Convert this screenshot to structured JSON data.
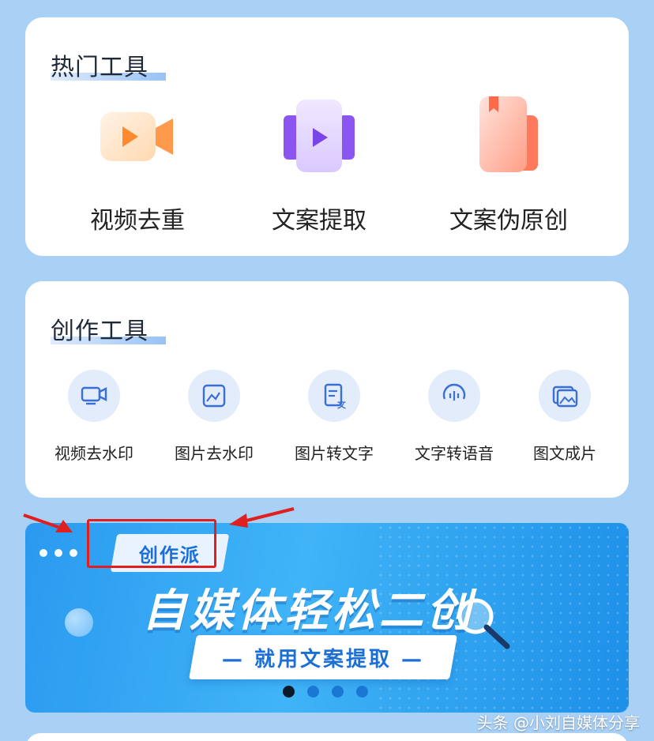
{
  "hot_tools": {
    "title": "热门工具",
    "items": [
      {
        "label": "视频去重",
        "icon": "video-camera-icon"
      },
      {
        "label": "文案提取",
        "icon": "film-play-icon"
      },
      {
        "label": "文案伪原创",
        "icon": "document-bookmark-icon"
      }
    ]
  },
  "creation_tools": {
    "title": "创作工具",
    "items": [
      {
        "label": "视频去水印",
        "icon": "video-watermark-icon"
      },
      {
        "label": "图片去水印",
        "icon": "image-watermark-icon"
      },
      {
        "label": "图片转文字",
        "icon": "image-to-text-icon"
      },
      {
        "label": "文字转语音",
        "icon": "text-to-speech-icon"
      },
      {
        "label": "图文成片",
        "icon": "image-gallery-icon"
      }
    ]
  },
  "banner": {
    "tag": "创作派",
    "headline": "自媒体轻松二创",
    "cta": "— 就用文案提取 —",
    "slide_count": 4,
    "active_slide": 1
  },
  "watermark": "头条 @小刘自媒体分享",
  "colors": {
    "background": "#a9d0f5",
    "card": "#ffffff",
    "accent_blue": "#2a9af0",
    "annotation_red": "#e02020"
  }
}
